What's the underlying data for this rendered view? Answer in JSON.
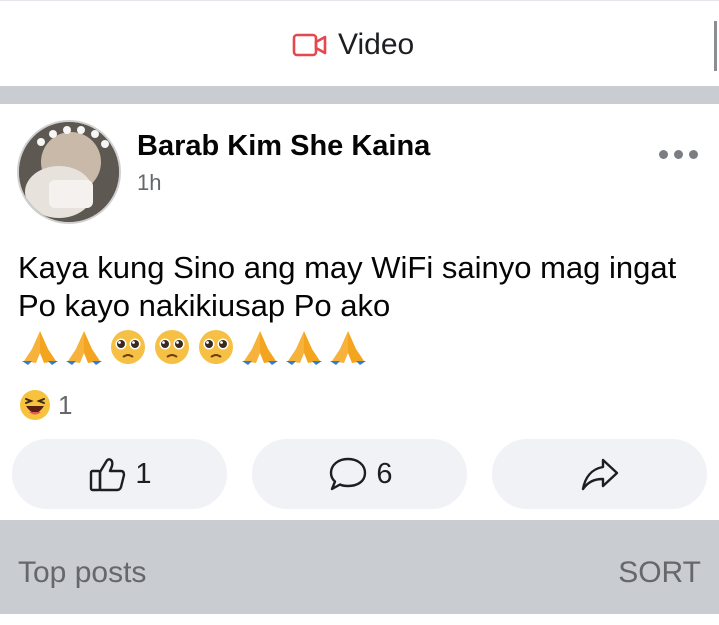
{
  "video_bar": {
    "label": "Video",
    "icon": "video-camera-icon",
    "accent": "#e4474d"
  },
  "post": {
    "author": "Barab Kim She Kaina",
    "timestamp": "1h",
    "text": "Kaya kung Sino ang may WiFi sainyo mag ingat Po kayo nakikiusap Po ako",
    "emojis": [
      "folded-hands",
      "folded-hands",
      "pleading-face",
      "pleading-face",
      "pleading-face",
      "folded-hands",
      "folded-hands",
      "folded-hands"
    ],
    "reaction": {
      "icon": "haha-reaction-icon",
      "count": "1"
    }
  },
  "actions": {
    "like": {
      "icon": "like-icon",
      "count": "1"
    },
    "comment": {
      "icon": "comment-icon",
      "count": "6"
    },
    "share": {
      "icon": "share-icon"
    }
  },
  "comments_header": {
    "title": "Top posts",
    "sort_label": "SORT"
  }
}
